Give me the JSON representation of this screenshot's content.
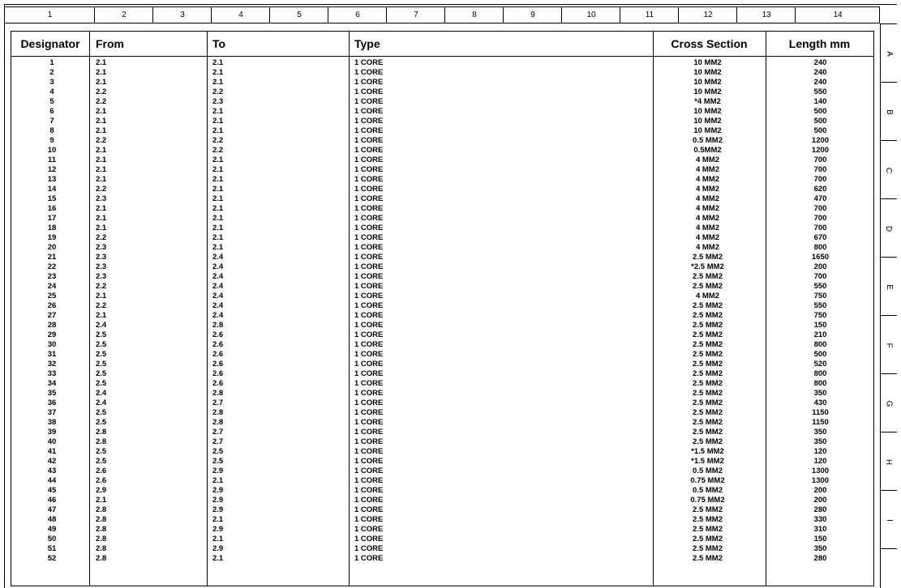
{
  "column_ruler": [
    "1",
    "2",
    "3",
    "4",
    "5",
    "6",
    "7",
    "8",
    "9",
    "10",
    "11",
    "12",
    "13",
    "14"
  ],
  "row_ruler": [
    "A",
    "B",
    "C",
    "D",
    "E",
    "F",
    "G",
    "H",
    "I"
  ],
  "table": {
    "headers": {
      "designator": "Designator",
      "from": "From",
      "to": "To",
      "type": "Type",
      "cross_section": "Cross Section",
      "length": "Length mm"
    },
    "rows": [
      [
        "1",
        "2.1",
        "2.1",
        "1 CORE",
        "10 MM2",
        "240"
      ],
      [
        "2",
        "2.1",
        "2.1",
        "1 CORE",
        "10 MM2",
        "240"
      ],
      [
        "3",
        "2.1",
        "2.1",
        "1 CORE",
        "10 MM2",
        "240"
      ],
      [
        "4",
        "2.2",
        "2.2",
        "1 CORE",
        "10 MM2",
        "550"
      ],
      [
        "5",
        "2.2",
        "2.3",
        "1 CORE",
        "*4 MM2",
        "140"
      ],
      [
        "6",
        "2.1",
        "2.1",
        "1 CORE",
        "10 MM2",
        "500"
      ],
      [
        "7",
        "2.1",
        "2.1",
        "1 CORE",
        "10 MM2",
        "500"
      ],
      [
        "8",
        "2.1",
        "2.1",
        "1 CORE",
        "10 MM2",
        "500"
      ],
      [
        "9",
        "2.2",
        "2.2",
        "1 CORE",
        "0.5 MM2",
        "1200"
      ],
      [
        "10",
        "2.1",
        "2.2",
        "1 CORE",
        "0.5MM2",
        "1200"
      ],
      [
        "11",
        "2.1",
        "2.1",
        "1 CORE",
        "4 MM2",
        "700"
      ],
      [
        "12",
        "2.1",
        "2.1",
        "1 CORE",
        "4 MM2",
        "700"
      ],
      [
        "13",
        "2.1",
        "2.1",
        "1 CORE",
        "4 MM2",
        "700"
      ],
      [
        "14",
        "2.2",
        "2.1",
        "1 CORE",
        "4 MM2",
        "620"
      ],
      [
        "15",
        "2.3",
        "2.1",
        "1 CORE",
        "4 MM2",
        "470"
      ],
      [
        "16",
        "2.1",
        "2.1",
        "1 CORE",
        "4 MM2",
        "700"
      ],
      [
        "17",
        "2.1",
        "2.1",
        "1 CORE",
        "4 MM2",
        "700"
      ],
      [
        "18",
        "2.1",
        "2.1",
        "1 CORE",
        "4 MM2",
        "700"
      ],
      [
        "19",
        "2.2",
        "2.1",
        "1 CORE",
        "4 MM2",
        "670"
      ],
      [
        "20",
        "2.3",
        "2.1",
        "1 CORE",
        "4 MM2",
        "800"
      ],
      [
        "21",
        "2.3",
        "2.4",
        "1 CORE",
        "2.5 MM2",
        "1650"
      ],
      [
        "22",
        "2.3",
        "2.4",
        "1 CORE",
        "*2.5 MM2",
        "200"
      ],
      [
        "23",
        "2.3",
        "2.4",
        "1 CORE",
        "2.5 MM2",
        "700"
      ],
      [
        "24",
        "2.2",
        "2.4",
        "1 CORE",
        "2.5 MM2",
        "550"
      ],
      [
        "25",
        "2.1",
        "2.4",
        "1 CORE",
        "4 MM2",
        "750"
      ],
      [
        "26",
        "2.2",
        "2.4",
        "1 CORE",
        "2.5 MM2",
        "550"
      ],
      [
        "27",
        "2.1",
        "2.4",
        "1 CORE",
        "2.5 MM2",
        "750"
      ],
      [
        "28",
        "2.4",
        "2.8",
        "1 CORE",
        "2.5 MM2",
        "150"
      ],
      [
        "29",
        "2.5",
        "2.6",
        "1 CORE",
        "2.5 MM2",
        "210"
      ],
      [
        "30",
        "2.5",
        "2.6",
        "1 CORE",
        "2.5 MM2",
        "800"
      ],
      [
        "31",
        "2.5",
        "2.6",
        "1 CORE",
        "2.5 MM2",
        "500"
      ],
      [
        "32",
        "2.5",
        "2.6",
        "1 CORE",
        "2.5 MM2",
        "520"
      ],
      [
        "33",
        "2.5",
        "2.6",
        "1 CORE",
        "2.5 MM2",
        "800"
      ],
      [
        "34",
        "2.5",
        "2.6",
        "1 CORE",
        "2.5 MM2",
        "800"
      ],
      [
        "35",
        "2.4",
        "2.8",
        "1 CORE",
        "2.5 MM2",
        "350"
      ],
      [
        "36",
        "2.4",
        "2.7",
        "1 CORE",
        "2.5 MM2",
        "430"
      ],
      [
        "37",
        "2.5",
        "2.8",
        "1 CORE",
        "2.5 MM2",
        "1150"
      ],
      [
        "38",
        "2.5",
        "2.8",
        "1 CORE",
        "2.5 MM2",
        "1150"
      ],
      [
        "39",
        "2.8",
        "2.7",
        "1 CORE",
        "2.5 MM2",
        "350"
      ],
      [
        "40",
        "2.8",
        "2.7",
        "1 CORE",
        "2.5 MM2",
        "350"
      ],
      [
        "41",
        "2.5",
        "2.5",
        "1 CORE",
        "*1.5 MM2",
        "120"
      ],
      [
        "42",
        "2.5",
        "2.5",
        "1 CORE",
        "*1.5 MM2",
        "120"
      ],
      [
        "43",
        "2.6",
        "2.9",
        "1 CORE",
        "0.5 MM2",
        "1300"
      ],
      [
        "44",
        "2.6",
        "2.1",
        "1 CORE",
        "0.75 MM2",
        "1300"
      ],
      [
        "45",
        "2.9",
        "2.9",
        "1 CORE",
        "0.5 MM2",
        "200"
      ],
      [
        "46",
        "2.1",
        "2.9",
        "1 CORE",
        "0.75 MM2",
        "200"
      ],
      [
        "47",
        "2.8",
        "2.9",
        "1 CORE",
        "2.5 MM2",
        "280"
      ],
      [
        "48",
        "2.8",
        "2.1",
        "1 CORE",
        "2.5 MM2",
        "330"
      ],
      [
        "49",
        "2.8",
        "2.9",
        "1 CORE",
        "2.5 MM2",
        "310"
      ],
      [
        "50",
        "2.8",
        "2.1",
        "1 CORE",
        "2.5 MM2",
        "150"
      ],
      [
        "51",
        "2.8",
        "2.9",
        "1 CORE",
        "2.5 MM2",
        "350"
      ],
      [
        "52",
        "2.8",
        "2.1",
        "1 CORE",
        "2.5 MM2",
        "280"
      ]
    ]
  }
}
